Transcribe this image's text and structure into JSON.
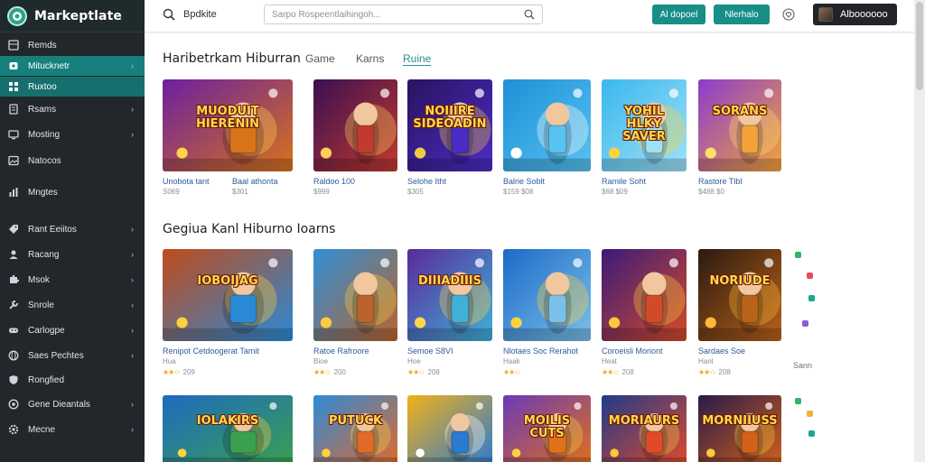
{
  "app": {
    "brand": "Markeptlate"
  },
  "sidebar": {
    "items": [
      {
        "label": "Remds",
        "icon": "grid-icon",
        "chevron": false
      },
      {
        "label": "Mitucknetr",
        "icon": "store-icon",
        "chevron": true
      },
      {
        "label": "Ruxtoo",
        "icon": "apps-icon",
        "chevron": false
      },
      {
        "label": "Rsams",
        "icon": "document-icon",
        "chevron": true
      },
      {
        "label": "Mosting",
        "icon": "monitor-icon",
        "chevron": true
      },
      {
        "label": "Natocos",
        "icon": "image-icon",
        "chevron": false
      },
      {
        "label": "Mngtes",
        "icon": "chart-icon",
        "chevron": false
      },
      {
        "label": "Rant Eeiitos",
        "icon": "tag-icon",
        "chevron": true
      },
      {
        "label": "Racang",
        "icon": "user-icon",
        "chevron": true
      },
      {
        "label": "Msok",
        "icon": "puzzle-icon",
        "chevron": true
      },
      {
        "label": "Snrole",
        "icon": "tools-icon",
        "chevron": true
      },
      {
        "label": "Carlogpe",
        "icon": "gamepad-icon",
        "chevron": true
      },
      {
        "label": "Saes Pechtes",
        "icon": "globe-icon",
        "chevron": true
      },
      {
        "label": "Rongfied",
        "icon": "shield-icon",
        "chevron": false
      },
      {
        "label": "Gene Dieantals",
        "icon": "support-icon",
        "chevron": true
      },
      {
        "label": "Mecne",
        "icon": "settings-icon",
        "chevron": true
      }
    ]
  },
  "header": {
    "label": "Bpdkite",
    "search_placeholder": "Sarpo Rospeentlaihingoh...",
    "btn_primary": "Al dopoel",
    "btn_secondary": "Nlerhalo",
    "account_name": "Alboooooo"
  },
  "section1": {
    "title": "Haribetrkam Hiburran",
    "tabs": [
      "Game",
      "Karns",
      "Ruine"
    ],
    "active_tab": 2,
    "cards": [
      {
        "art": "MUODUIT HIERENIN",
        "title": "Unobota tant",
        "sub": "S069",
        "title2": "Baal athonta",
        "sub2": "$301"
      },
      {
        "art": "",
        "title": "Raldoo 100",
        "sub": "$999"
      },
      {
        "art": "NOIIIRE SIDEOADIN",
        "title": "Selohe Itht",
        "sub": "$305"
      },
      {
        "art": "",
        "title": "Balrie Soblt",
        "sub": "$159 $08"
      },
      {
        "art": "YOHIL HLKY SAVER",
        "title": "Ramile Soht",
        "sub": "$68 $09"
      },
      {
        "art": "SORANS",
        "title": "Rastore Tlbl",
        "sub": "$488 $0"
      }
    ]
  },
  "section2": {
    "title": "Gegiua Kanl Hiburno Ioarns",
    "cards": [
      {
        "art": "IOBOIJAG",
        "title": "Renipot Cetdoogerat Tamit",
        "sub": "Hua",
        "rating": "209"
      },
      {
        "art": "",
        "title": "Ratoe Rafroore",
        "sub": "Bioe",
        "rating": "200"
      },
      {
        "art": "DIIIADIIIS",
        "title": "Semoe S8VI",
        "sub": "Hoe",
        "rating": "208"
      },
      {
        "art": "",
        "title": "Nlotaes Soc Rerahot",
        "sub": "Haak",
        "rating": ""
      },
      {
        "art": "",
        "title": "Coroeisli Moriont",
        "sub": "Heat",
        "rating": "208"
      },
      {
        "art": "NORIUDE",
        "title": "Sardaes Soe",
        "sub": "Hanl",
        "rating": "208"
      }
    ],
    "note": "Sann"
  },
  "section3": {
    "cards": [
      {
        "art": "IOLAKIRS"
      },
      {
        "art": "PUTUCK"
      },
      {
        "art": ""
      },
      {
        "art": "MOILIS CUTS"
      },
      {
        "art": "MORIAURS"
      },
      {
        "art": "MORNIIUSS"
      }
    ]
  },
  "colors": {
    "sidebar_bg": "#22272c",
    "accent": "#178e86",
    "link": "#2c5aa0",
    "star": "#f1a814"
  }
}
